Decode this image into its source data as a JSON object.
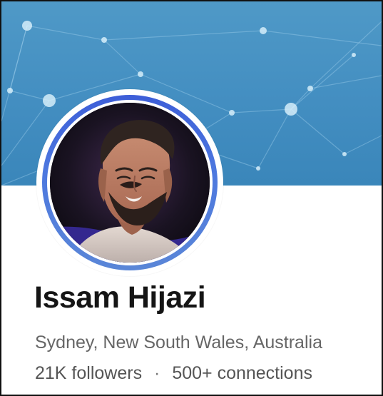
{
  "profile": {
    "name": "Issam Hijazi",
    "location": "Sydney, New South Wales, Australia",
    "followers": "21K followers",
    "separator": "·",
    "connections": "500+ connections"
  },
  "colors": {
    "banner": "#438ec1",
    "avatar_ring": "#4d78df",
    "name_text": "#151515",
    "secondary_text": "#666666"
  },
  "icons": {
    "banner_network_pattern": "network-pattern-icon",
    "profile_photo": "avatar"
  }
}
